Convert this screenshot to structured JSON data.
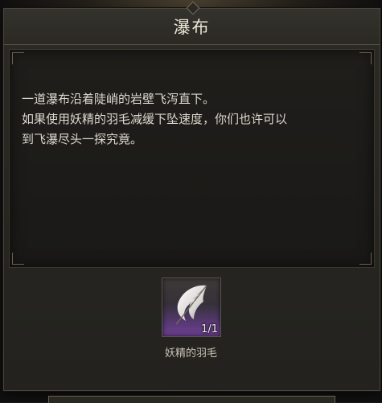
{
  "dialog": {
    "title": "瀑布",
    "description_lines": [
      "一道瀑布沿着陡峭的岩壁飞泻直下。",
      "如果使用妖精的羽毛减缓下坠速度，你们也许可以",
      "到飞瀑尽头一探究竟。"
    ]
  },
  "item": {
    "icon": "feather-icon",
    "count": "1/1",
    "name": "妖精的羽毛",
    "rarity_color": "#6d3f93"
  }
}
